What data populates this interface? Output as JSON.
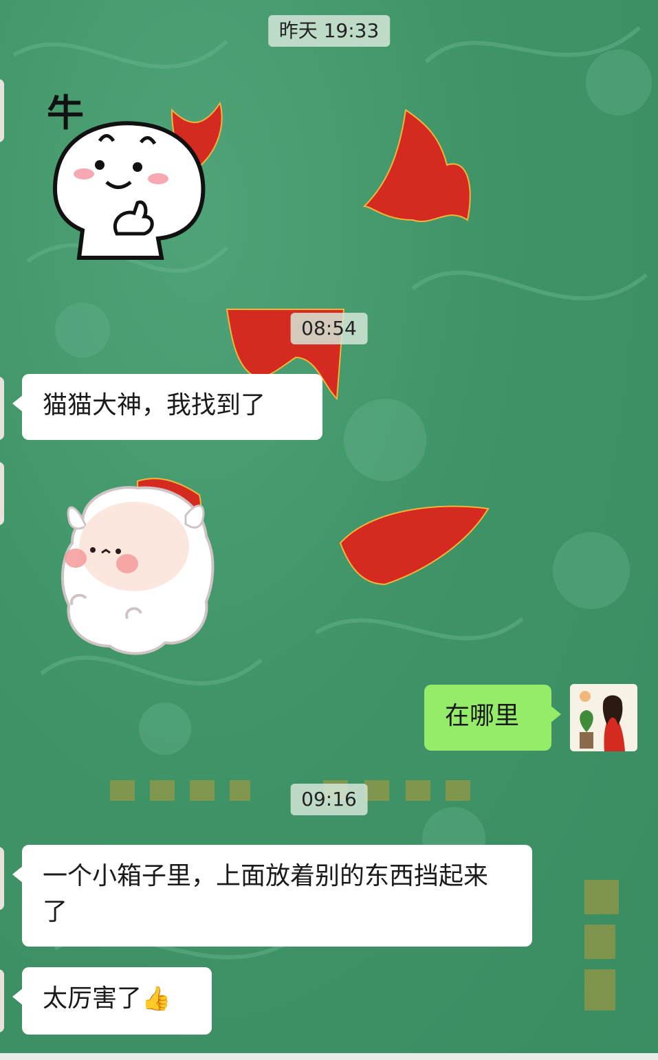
{
  "chat": {
    "messages": [
      {
        "type": "timestamp",
        "text": "昨天 19:33"
      },
      {
        "type": "sticker",
        "side": "left",
        "caption": "牛",
        "icon": "thumbs-up-mochi-sticker"
      },
      {
        "type": "timestamp",
        "text": "08:54"
      },
      {
        "type": "text",
        "side": "left",
        "text": "猫猫大神，我找到了"
      },
      {
        "type": "sticker",
        "side": "left",
        "icon": "fluffy-sheep-sticker"
      },
      {
        "type": "text",
        "side": "right",
        "text": "在哪里"
      },
      {
        "type": "timestamp",
        "text": "09:16"
      },
      {
        "type": "text",
        "side": "left",
        "text": "一个小箱子里，上面放着别的东西挡起来了"
      },
      {
        "type": "text",
        "side": "left",
        "text": "太厉害了",
        "emoji": "👍"
      }
    ]
  },
  "wallpaper": {
    "colors": {
      "green": "#3f9467",
      "red": "#d42a1f",
      "gold": "#b79a3a"
    }
  }
}
